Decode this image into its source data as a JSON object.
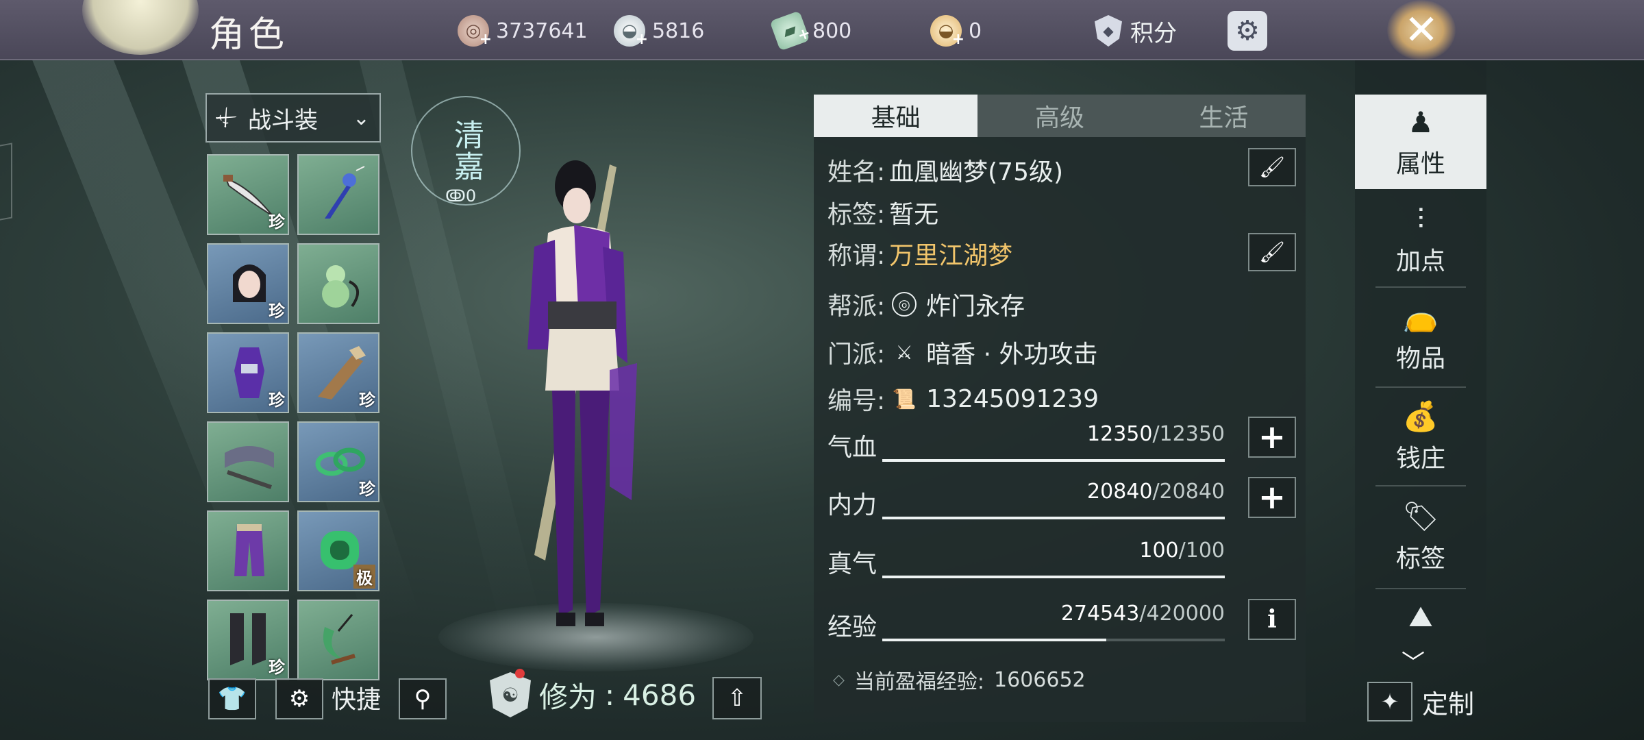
{
  "header": {
    "title": "角色",
    "currencies": [
      {
        "icon": "copper-coin-icon",
        "value": "3737641"
      },
      {
        "icon": "silver-ingot-icon",
        "value": "5816"
      },
      {
        "icon": "jade-ticket-icon",
        "value": "800"
      },
      {
        "icon": "gold-ingot-icon",
        "value": "0"
      }
    ],
    "points_label": "积分",
    "close_label": "✕"
  },
  "left": {
    "outfit_label": "战斗装",
    "slots": [
      {
        "icon": "dagger-icon",
        "rarity": "珍"
      },
      {
        "icon": "tassel-pendant-icon",
        "rarity": ""
      },
      {
        "icon": "character-portrait-icon",
        "rarity": "珍"
      },
      {
        "icon": "jade-gourd-icon",
        "rarity": ""
      },
      {
        "icon": "chest-armor-icon",
        "rarity": "珍"
      },
      {
        "icon": "gauntlet-icon",
        "rarity": "珍"
      },
      {
        "icon": "belt-icon",
        "rarity": ""
      },
      {
        "icon": "jade-rings-icon",
        "rarity": "珍"
      },
      {
        "icon": "leg-armor-icon",
        "rarity": ""
      },
      {
        "icon": "jade-bangle-icon",
        "rarity": "极"
      },
      {
        "icon": "boots-icon",
        "rarity": "珍"
      },
      {
        "icon": "crescent-pendant-icon",
        "rarity": ""
      }
    ],
    "shortcut_label": "快捷"
  },
  "character": {
    "emblem_text": "清嘉",
    "emblem_count": "0",
    "cultivation_label": "修为",
    "cultivation_value": "4686"
  },
  "panel": {
    "tabs": [
      "基础",
      "高级",
      "生活"
    ],
    "active_tab": 0,
    "name_label": "姓名:",
    "name_value": "血凰幽梦(75级)",
    "tag_label": "标签:",
    "tag_value": "暂无",
    "title_label": "称谓:",
    "title_value": "万里江湖梦",
    "guild_label": "帮派:",
    "guild_value": "炸门永存",
    "sect_label": "门派:",
    "sect_value": "暗香 · 外功攻击",
    "id_label": "编号:",
    "id_value": "13245091239",
    "stats": [
      {
        "label": "气血",
        "current": "12350",
        "max": "/12350",
        "fraction": 1.0,
        "has_plus": true
      },
      {
        "label": "内力",
        "current": "20840",
        "max": "/20840",
        "fraction": 1.0,
        "has_plus": true
      },
      {
        "label": "真气",
        "current": "100",
        "max": "/100",
        "fraction": 1.0,
        "has_plus": false
      },
      {
        "label": "经验",
        "current": "274543",
        "max": "/420000",
        "fraction": 0.654,
        "has_plus": false
      }
    ],
    "bonus_exp_label": "当前盈福经验:",
    "bonus_exp_value": "1606652"
  },
  "sidemenu": {
    "items": [
      {
        "label": "属性",
        "icon": "hat-person-icon"
      },
      {
        "label": "加点",
        "icon": "sliders-icon"
      },
      {
        "label": "物品",
        "icon": "bag-icon"
      },
      {
        "label": "钱庄",
        "icon": "money-bags-icon"
      },
      {
        "label": "标签",
        "icon": "tag-icon"
      }
    ],
    "custom_label": "定制"
  },
  "colors": {
    "accent_gold": "#f2c56b",
    "panel_bg": "#212b2b",
    "active_tab": "#e9eded"
  }
}
